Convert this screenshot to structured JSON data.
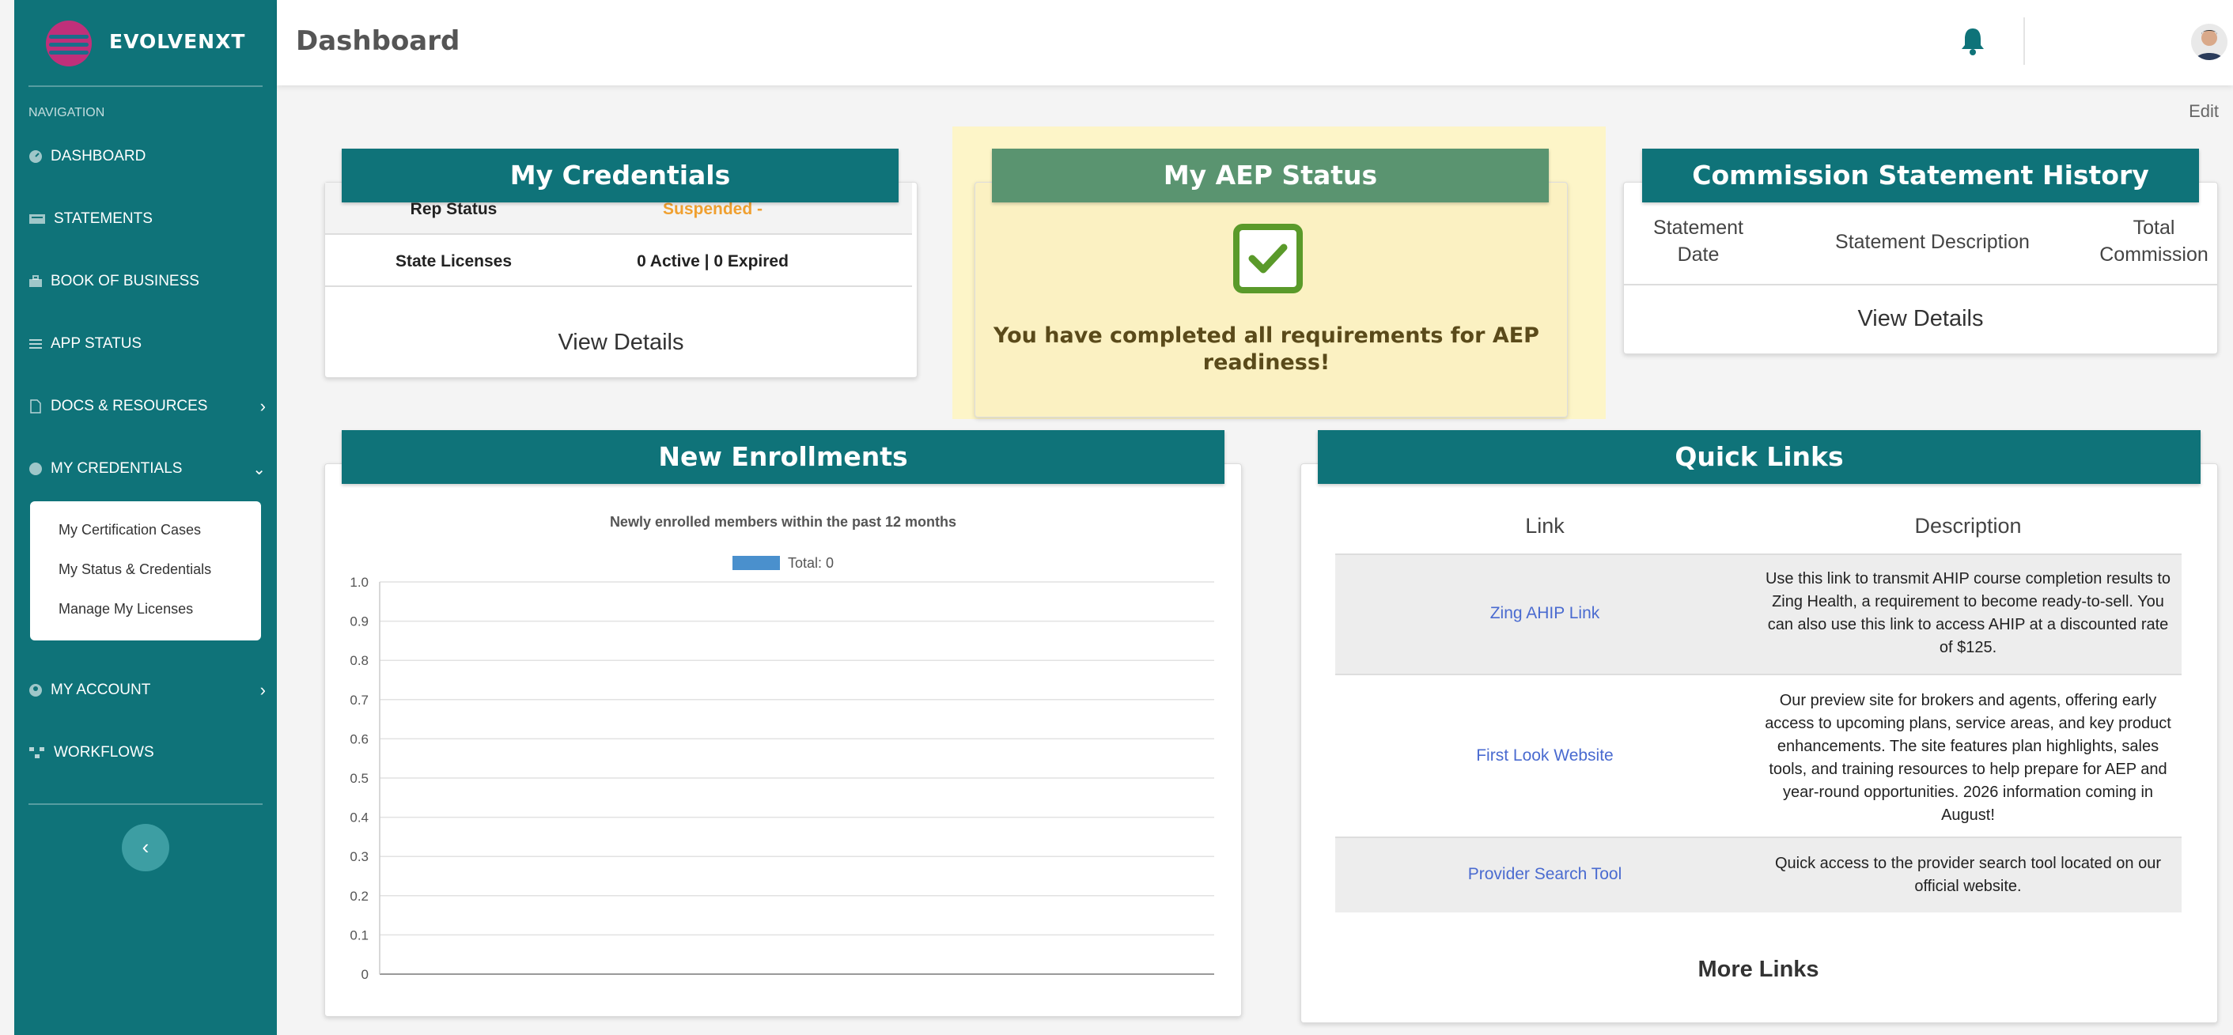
{
  "brand": {
    "name": "EVOLVENXT"
  },
  "header": {
    "title": "Dashboard",
    "edit_label": "Edit"
  },
  "sidebar": {
    "caption": "NAVIGATION",
    "items": [
      {
        "label": "DASHBOARD"
      },
      {
        "label": "STATEMENTS"
      },
      {
        "label": "BOOK OF BUSINESS"
      },
      {
        "label": "APP STATUS"
      },
      {
        "label": "DOCS & RESOURCES"
      },
      {
        "label": "MY CREDENTIALS"
      },
      {
        "label": "MY ACCOUNT"
      },
      {
        "label": "WORKFLOWS"
      }
    ],
    "submenu": [
      {
        "label": "My Certification Cases"
      },
      {
        "label": "My Status & Credentials"
      },
      {
        "label": "Manage My Licenses"
      }
    ]
  },
  "credentials": {
    "title": "My Credentials",
    "rows": [
      {
        "label": "Rep Status",
        "value": "Suspended -"
      },
      {
        "label": "State Licenses",
        "value": "0 Active | 0 Expired"
      }
    ],
    "view_details": "View Details",
    "colors": {
      "suspended": "#f0a030"
    }
  },
  "aep": {
    "title": "My AEP Status",
    "message": "You have completed all requirements for AEP readiness!",
    "icon": "checkbox-check-icon"
  },
  "commission": {
    "title": "Commission Statement History",
    "columns": [
      "Statement Date",
      "Statement Description",
      "Total Commission"
    ],
    "view_details": "View Details"
  },
  "enrollments": {
    "title": "New Enrollments"
  },
  "chart_data": {
    "type": "bar",
    "title": "Newly enrolled members within the past 12 months",
    "series": [
      {
        "name": "Total: 0",
        "values": []
      }
    ],
    "ylim": [
      0,
      1
    ],
    "yticks": [
      "1.0",
      "0.9",
      "0.8",
      "0.7",
      "0.6",
      "0.5",
      "0.4",
      "0.3",
      "0.2",
      "0.1",
      "0"
    ],
    "grid": true,
    "legend": "top"
  },
  "quick_links": {
    "title": "Quick Links",
    "columns": [
      "Link",
      "Description"
    ],
    "rows": [
      {
        "link": "Zing AHIP Link",
        "description": "Use this link to transmit AHIP course completion results to Zing Health, a requirement to become ready-to-sell. You can also use this link to access AHIP at a discounted rate of $125."
      },
      {
        "link": "First Look Website",
        "description": "Our preview site for brokers and agents, offering early access to upcoming plans, service areas, and key product enhancements. The site features plan highlights, sales tools, and training resources to help prepare for AEP and year-round opportunities. 2026 information coming in August!"
      },
      {
        "link": "Provider Search Tool",
        "description": "Quick access to the provider search tool located on our official website."
      }
    ],
    "more_label": "More Links"
  },
  "colors": {
    "teal": "#0f7379",
    "aep_head": "#5a9470",
    "aep_bg": "#fdf5c8",
    "check": "#5a9a2a"
  }
}
